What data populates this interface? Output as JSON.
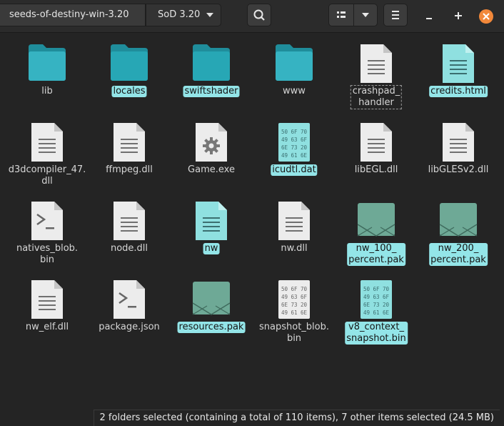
{
  "path_bar": {
    "segment_1": "seeds-of-destiny-win-3.20",
    "segment_2": "SoD 3.20"
  },
  "files": [
    {
      "name": "lib",
      "type": "folder"
    },
    {
      "name": "locales",
      "type": "folder",
      "selected": true
    },
    {
      "name": "swiftshader",
      "type": "folder",
      "selected": true
    },
    {
      "name": "www",
      "type": "folder"
    },
    {
      "name": "crashpad_ handler",
      "type": "text"
    },
    {
      "name": "credits.html",
      "type": "text",
      "selected": true
    },
    {
      "name": "d3dcompiler_47. dll",
      "type": "text"
    },
    {
      "name": "ffmpeg.dll",
      "type": "text"
    },
    {
      "name": "Game.exe",
      "type": "exec"
    },
    {
      "name": "icudtl.dat",
      "type": "binary",
      "selected": true
    },
    {
      "name": "libEGL.dll",
      "type": "text"
    },
    {
      "name": "libGLESv2.dll",
      "type": "text"
    },
    {
      "name": "natives_blob. bin",
      "type": "script"
    },
    {
      "name": "node.dll",
      "type": "text"
    },
    {
      "name": "nw",
      "type": "text",
      "selected": true
    },
    {
      "name": "nw.dll",
      "type": "text"
    },
    {
      "name": "nw_100_ percent.pak",
      "type": "package",
      "selected": true
    },
    {
      "name": "nw_200_ percent.pak",
      "type": "package",
      "selected": true
    },
    {
      "name": "nw_elf.dll",
      "type": "text"
    },
    {
      "name": "package.json",
      "type": "script"
    },
    {
      "name": "resources.pak",
      "type": "package",
      "selected": true
    },
    {
      "name": "snapshot_blob. bin",
      "type": "binary"
    },
    {
      "name": "v8_context_ snapshot.bin",
      "type": "binary",
      "selected": true
    }
  ],
  "hex_preview": [
    "50 6F 70",
    "49 63 6F",
    "6E 73 20",
    "49 61 6E"
  ],
  "status_bar": "2 folders selected (containing a total of 110 items), 7 other items selected (24.5 MB)",
  "colors": {
    "accent": "#93e5e8",
    "folder": "#36b3c2",
    "close_button": "#f2883a"
  }
}
